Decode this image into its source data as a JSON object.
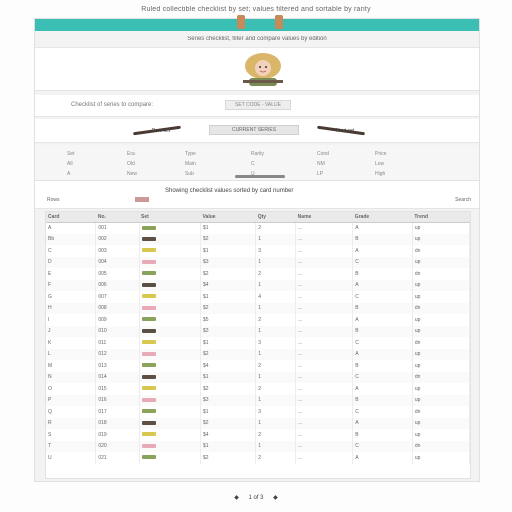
{
  "page": {
    "caption": "Ruled collectible checklist by set; values filtered and sortable by rarity",
    "subtitle": "Series checklist, filter and compare values by edition"
  },
  "colors": {
    "header_bar": "#3bbfb4",
    "tag": "#c98a5a",
    "swatch_green": "#8aa35a",
    "swatch_dark": "#5b5043",
    "swatch_yellow": "#d9c84f",
    "swatch_pink": "#e9a9b6"
  },
  "hero": {
    "icon": "character-artwork-icon"
  },
  "info": {
    "text": "Checklist of series to compare:",
    "code": "SET CODE - VALUE"
  },
  "nav": {
    "prev_label": "Prev set",
    "next_label": "Next set",
    "current": "CURRENT SERIES"
  },
  "filters": {
    "col1": [
      "Set",
      "All",
      "A"
    ],
    "col2": [
      "Era",
      "Old",
      "New"
    ],
    "col3": [
      "Type",
      "Main",
      "Sub"
    ],
    "col4": [
      "Rarity",
      "C",
      "U"
    ],
    "col5": [
      "Cond",
      "NM",
      "LP"
    ],
    "col6": [
      "Price",
      "Low",
      "High"
    ]
  },
  "toolbar": {
    "title": "Showing checklist values sorted by card number",
    "left": "Rows",
    "right": "Search"
  },
  "table": {
    "headers": [
      "Card",
      "No.",
      "Set",
      "Value",
      "Qty",
      "Name",
      "Grade",
      "Trend"
    ],
    "rows": [
      [
        "A",
        "001",
        "",
        "$1",
        "2",
        "...",
        "A",
        "up"
      ],
      [
        "Bb",
        "002",
        "",
        "$2",
        "1",
        "...",
        "B",
        "up"
      ],
      [
        "C",
        "003",
        "",
        "$1",
        "3",
        "...",
        "A",
        "dn"
      ],
      [
        "D",
        "004",
        "",
        "$3",
        "1",
        "...",
        "C",
        "up"
      ],
      [
        "E",
        "005",
        "",
        "$2",
        "2",
        "...",
        "B",
        "dn"
      ],
      [
        "F",
        "006",
        "",
        "$4",
        "1",
        "...",
        "A",
        "up"
      ],
      [
        "G",
        "007",
        "",
        "$1",
        "4",
        "...",
        "C",
        "up"
      ],
      [
        "H",
        "008",
        "",
        "$2",
        "1",
        "...",
        "B",
        "dn"
      ],
      [
        "I",
        "009",
        "",
        "$5",
        "2",
        "...",
        "A",
        "up"
      ],
      [
        "J",
        "010",
        "",
        "$3",
        "1",
        "...",
        "B",
        "up"
      ],
      [
        "K",
        "011",
        "",
        "$1",
        "3",
        "...",
        "C",
        "dn"
      ],
      [
        "L",
        "012",
        "",
        "$2",
        "1",
        "...",
        "A",
        "up"
      ],
      [
        "M",
        "013",
        "",
        "$4",
        "2",
        "...",
        "B",
        "up"
      ],
      [
        "N",
        "014",
        "",
        "$1",
        "1",
        "...",
        "C",
        "dn"
      ],
      [
        "O",
        "015",
        "",
        "$2",
        "2",
        "...",
        "A",
        "up"
      ],
      [
        "P",
        "016",
        "",
        "$3",
        "1",
        "...",
        "B",
        "up"
      ],
      [
        "Q",
        "017",
        "",
        "$1",
        "3",
        "...",
        "C",
        "dn"
      ],
      [
        "R",
        "018",
        "",
        "$2",
        "1",
        "...",
        "A",
        "up"
      ],
      [
        "S",
        "019",
        "",
        "$4",
        "2",
        "...",
        "B",
        "up"
      ],
      [
        "T",
        "020",
        "",
        "$1",
        "1",
        "...",
        "C",
        "dn"
      ],
      [
        "U",
        "021",
        "",
        "$2",
        "2",
        "...",
        "A",
        "up"
      ]
    ]
  },
  "pager": {
    "prev": "◆",
    "label": "1 of 3",
    "next": "◆"
  }
}
